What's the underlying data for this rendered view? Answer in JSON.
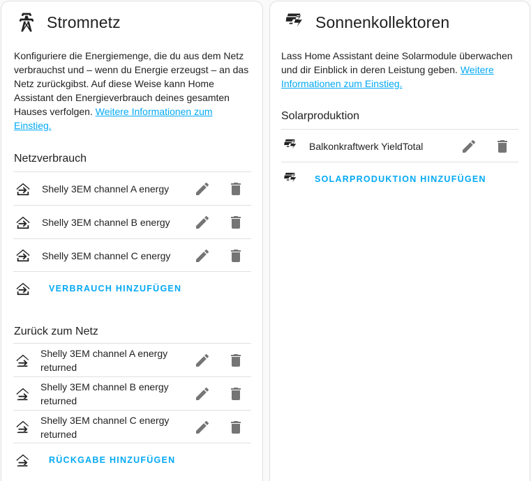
{
  "grid": {
    "title": "Stromnetz",
    "icon": "transmission-tower-icon",
    "description": "Konfiguriere die Energiemenge, die du aus dem Netz verbrauchst und – wenn du Energie erzeugst – an das Netz zurückgibst. Auf diese Weise kann Home Assistant den Energieverbrauch deines gesamten Hauses verfolgen.",
    "link": "Weitere Informationen zum Einstieg.",
    "consumption": {
      "title": "Netzverbrauch",
      "items": [
        {
          "label": "Shelly 3EM channel A energy"
        },
        {
          "label": "Shelly 3EM channel B energy"
        },
        {
          "label": "Shelly 3EM channel C energy"
        }
      ],
      "add_label": "VERBRAUCH HINZUFÜGEN"
    },
    "return": {
      "title": "Zurück zum Netz",
      "items": [
        {
          "label_line1": "Shelly 3EM channel A energy",
          "label_line2": "returned"
        },
        {
          "label_line1": "Shelly 3EM channel B energy",
          "label_line2": "returned"
        },
        {
          "label_line1": "Shelly 3EM channel C energy",
          "label_line2": "returned"
        }
      ],
      "add_label": "RÜCKGABE HINZUFÜGEN"
    }
  },
  "solar": {
    "title": "Sonnenkollektoren",
    "icon": "solar-power-icon",
    "description": "Lass Home Assistant deine Solarmodule überwachen und dir Einblick in deren Leistung geben.",
    "link": "Weitere Informationen zum Einstieg.",
    "production": {
      "title": "Solarproduktion",
      "items": [
        {
          "label": "Balkonkraftwerk YieldTotal"
        }
      ],
      "add_label": "SOLARPRODUKTION HINZUFÜGEN"
    }
  },
  "colors": {
    "accent": "#03a9f4",
    "icon_gray": "#757575",
    "divider": "#e0e0e0"
  }
}
